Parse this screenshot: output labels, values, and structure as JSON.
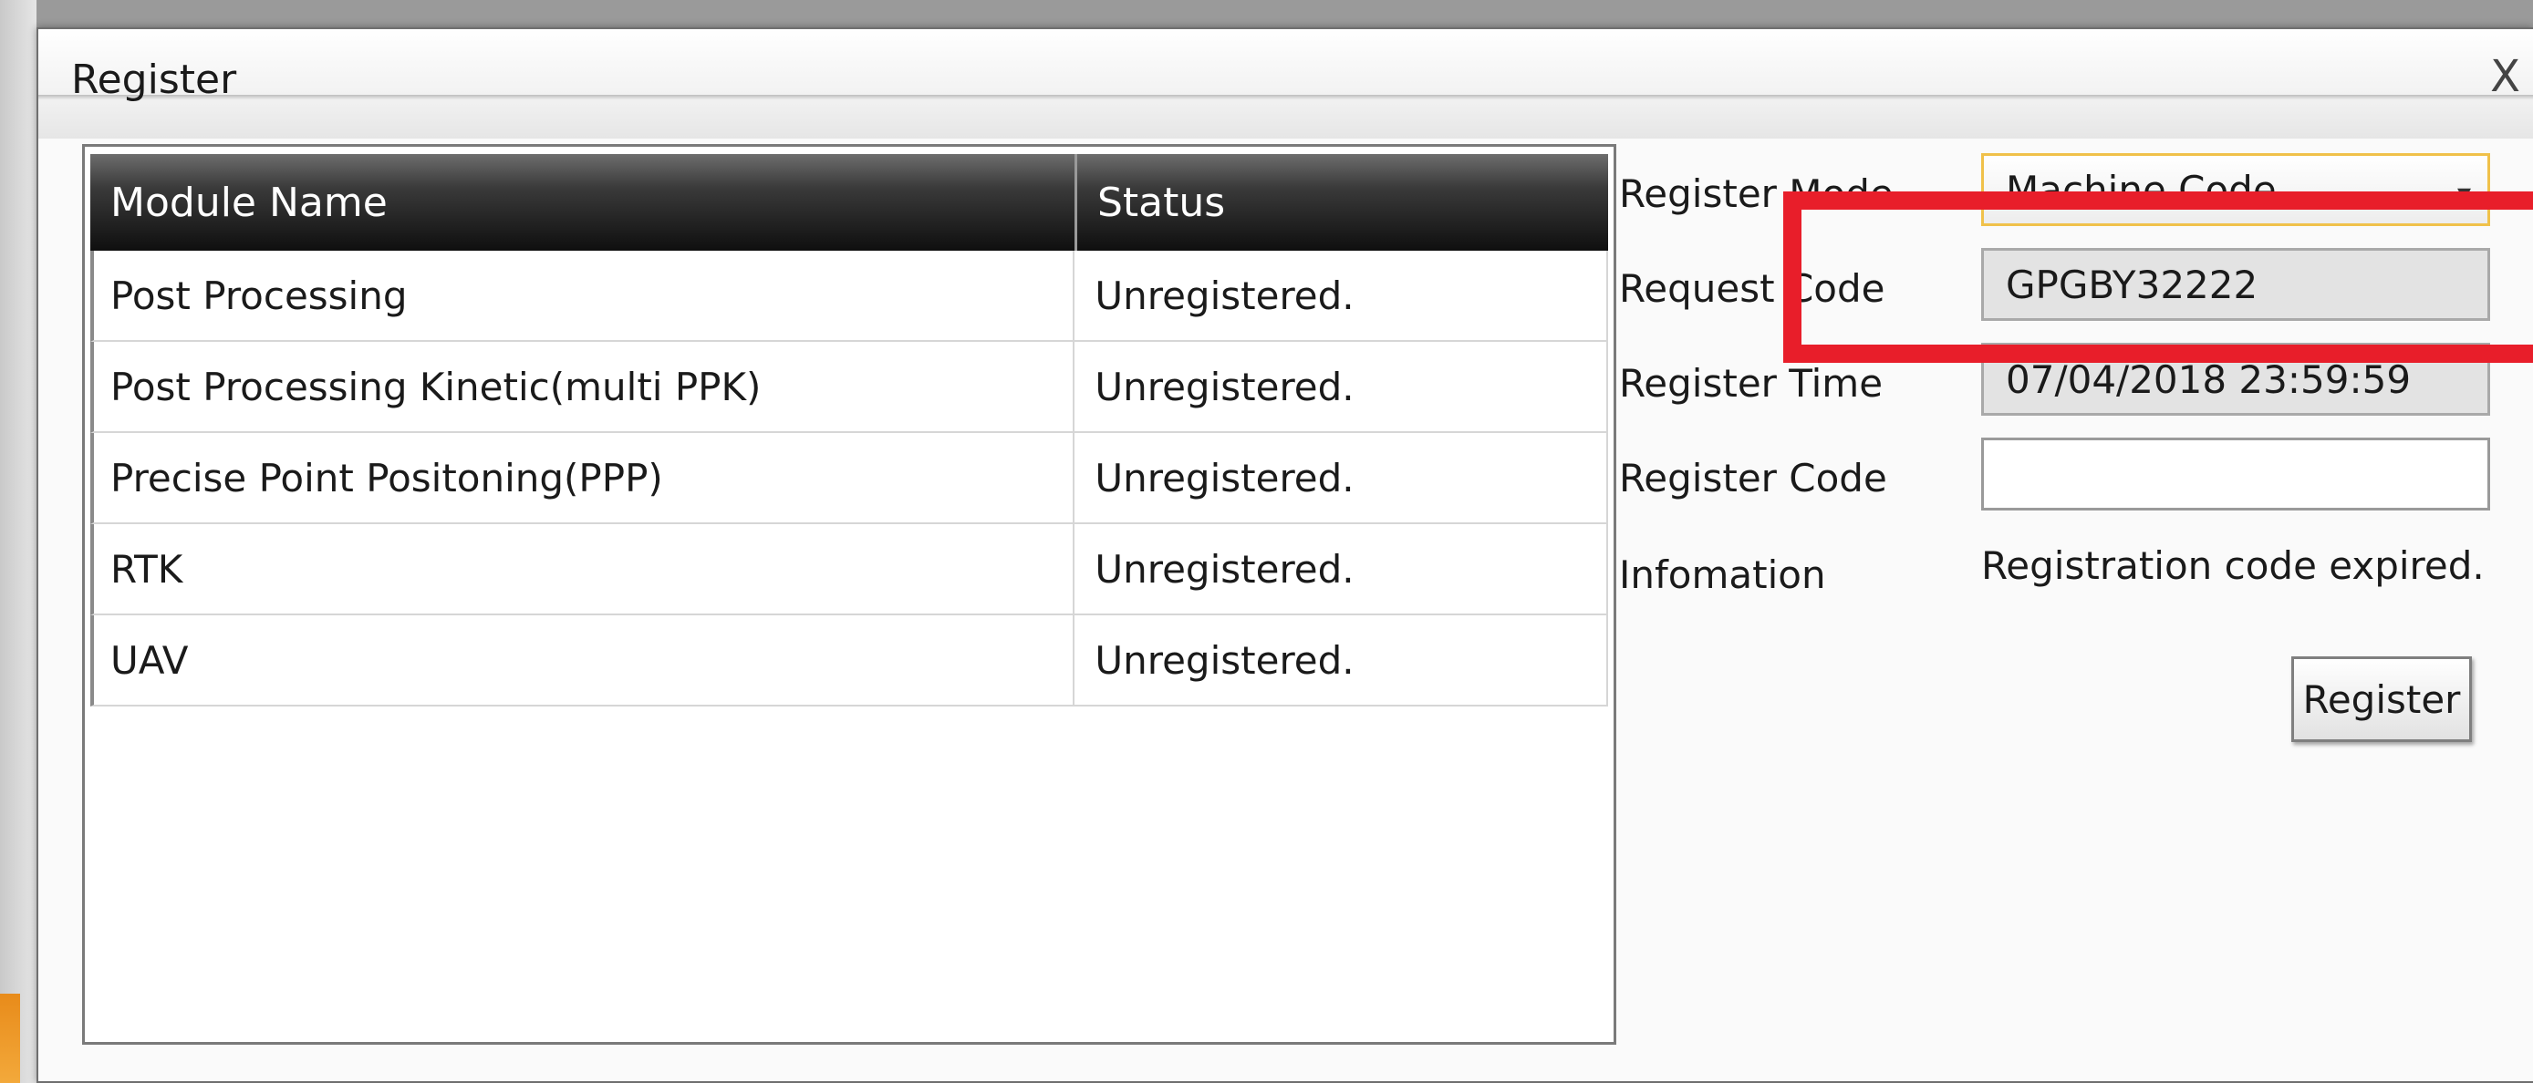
{
  "window": {
    "title": "Register",
    "close_label": "X"
  },
  "modules_table": {
    "headers": [
      "Module Name",
      "Status"
    ],
    "rows": [
      {
        "name": "Post Processing",
        "status": "Unregistered."
      },
      {
        "name": "Post Processing Kinetic(multi PPK)",
        "status": "Unregistered."
      },
      {
        "name": "Precise Point Positoning(PPP)",
        "status": "Unregistered."
      },
      {
        "name": "RTK",
        "status": "Unregistered."
      },
      {
        "name": "UAV",
        "status": "Unregistered."
      }
    ]
  },
  "form": {
    "register_mode_label": "Register Mode",
    "register_mode_value": "Machine Code",
    "request_code_label": "Request Code",
    "request_code_value": "GPGBY32222",
    "register_time_label": "Register Time",
    "register_time_value": "07/04/2018 23:59:59",
    "register_code_label": "Register Code",
    "register_code_value": "",
    "information_label": "Infomation",
    "information_value": "Registration code expired.",
    "register_button_label": "Register"
  },
  "annotation": {
    "highlight_color": "#e81e2a"
  },
  "icons": {
    "dropdown_arrow": "chevron-down-icon"
  }
}
